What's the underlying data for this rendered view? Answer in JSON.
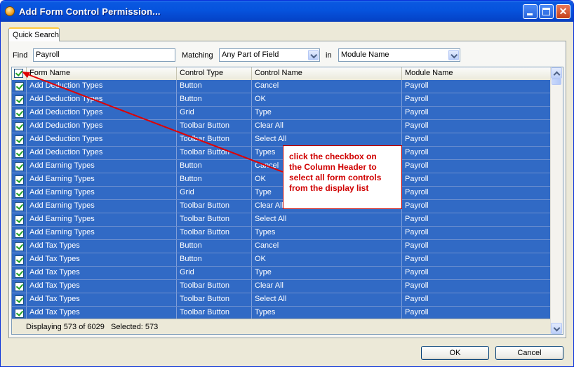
{
  "window": {
    "title": "Add Form Control Permission...",
    "accent_color": "#0653dd",
    "controls": {
      "minimize": "minimize-icon",
      "maximize": "maximize-icon",
      "close": "close-icon",
      "close_glyph": "✕"
    }
  },
  "tabs": [
    {
      "label": "Quick Search",
      "selected": true
    }
  ],
  "search": {
    "find_label": "Find",
    "find_value": "Payroll",
    "matching_label": "Matching",
    "matching_value": "Any Part of Field",
    "in_label": "in",
    "in_value": "Module Name"
  },
  "grid": {
    "select_all_checked": true,
    "columns": [
      "Form Name",
      "Control Type",
      "Control Name",
      "Module Name"
    ],
    "selection_color": "#316ac5",
    "rows": [
      {
        "form": "Add Deduction Types",
        "type": "Button",
        "control": "Cancel",
        "module": "Payroll"
      },
      {
        "form": "Add Deduction Types",
        "type": "Button",
        "control": "OK",
        "module": "Payroll"
      },
      {
        "form": "Add Deduction Types",
        "type": "Grid",
        "control": "Type",
        "module": "Payroll"
      },
      {
        "form": "Add Deduction Types",
        "type": "Toolbar Button",
        "control": "Clear All",
        "module": "Payroll"
      },
      {
        "form": "Add Deduction Types",
        "type": "Toolbar Button",
        "control": "Select All",
        "module": "Payroll"
      },
      {
        "form": "Add Deduction Types",
        "type": "Toolbar Button",
        "control": "Types",
        "module": "Payroll"
      },
      {
        "form": "Add Earning Types",
        "type": "Button",
        "control": "Cancel",
        "module": "Payroll"
      },
      {
        "form": "Add Earning Types",
        "type": "Button",
        "control": "OK",
        "module": "Payroll"
      },
      {
        "form": "Add Earning Types",
        "type": "Grid",
        "control": "Type",
        "module": "Payroll"
      },
      {
        "form": "Add Earning Types",
        "type": "Toolbar Button",
        "control": "Clear All",
        "module": "Payroll"
      },
      {
        "form": "Add Earning Types",
        "type": "Toolbar Button",
        "control": "Select All",
        "module": "Payroll"
      },
      {
        "form": "Add Earning Types",
        "type": "Toolbar Button",
        "control": "Types",
        "module": "Payroll"
      },
      {
        "form": "Add Tax Types",
        "type": "Button",
        "control": "Cancel",
        "module": "Payroll"
      },
      {
        "form": "Add Tax Types",
        "type": "Button",
        "control": "OK",
        "module": "Payroll"
      },
      {
        "form": "Add Tax Types",
        "type": "Grid",
        "control": "Type",
        "module": "Payroll"
      },
      {
        "form": "Add Tax Types",
        "type": "Toolbar Button",
        "control": "Clear All",
        "module": "Payroll"
      },
      {
        "form": "Add Tax Types",
        "type": "Toolbar Button",
        "control": "Select All",
        "module": "Payroll"
      },
      {
        "form": "Add Tax Types",
        "type": "Toolbar Button",
        "control": "Types",
        "module": "Payroll"
      }
    ],
    "status_displaying": "Displaying 573 of 6029",
    "status_selected": "Selected: 573"
  },
  "callout": {
    "lines": [
      "click the checkbox on",
      "the Column Header to",
      "select all form controls",
      "from the display list"
    ],
    "color": "#d00000"
  },
  "buttons": {
    "ok": "OK",
    "cancel": "Cancel"
  }
}
